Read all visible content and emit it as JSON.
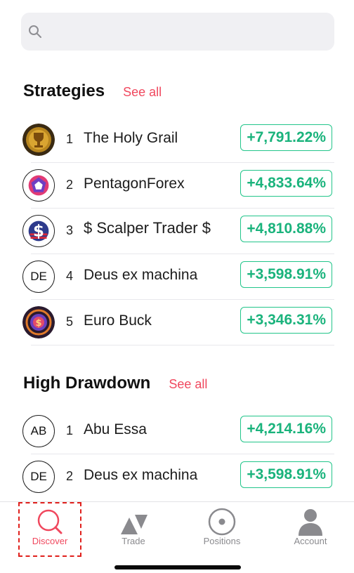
{
  "search": {
    "placeholder": ""
  },
  "strategies": {
    "title": "Strategies",
    "see_all": "See all",
    "items": [
      {
        "rank": "1",
        "name": "The Holy Grail",
        "pct": "+7,791.22%",
        "avatar": "trophy-icon"
      },
      {
        "rank": "2",
        "name": "PentagonForex",
        "pct": "+4,833.64%",
        "avatar": "pentagon-logo"
      },
      {
        "rank": "3",
        "name": "$ Scalper Trader $",
        "pct": "+4,810.88%",
        "avatar": "dollar-flag-logo"
      },
      {
        "rank": "4",
        "name": "Deus ex machina",
        "pct": "+3,598.91%",
        "initials": "DE"
      },
      {
        "rank": "5",
        "name": "Euro Buck",
        "pct": "+3,346.31%",
        "avatar": "coin-logo"
      }
    ]
  },
  "drawdown": {
    "title": "High Drawdown",
    "see_all": "See all",
    "items": [
      {
        "rank": "1",
        "name": "Abu Essa",
        "pct": "+4,214.16%",
        "initials": "AB"
      },
      {
        "rank": "2",
        "name": "Deus ex machina",
        "pct": "+3,598.91%",
        "initials": "DE"
      }
    ]
  },
  "tabbar": {
    "discover": "Discover",
    "trade": "Trade",
    "positions": "Positions",
    "account": "Account"
  },
  "colors": {
    "accent": "#f0485e",
    "positive": "#1ab37c",
    "positive_border": "#22c58a"
  }
}
